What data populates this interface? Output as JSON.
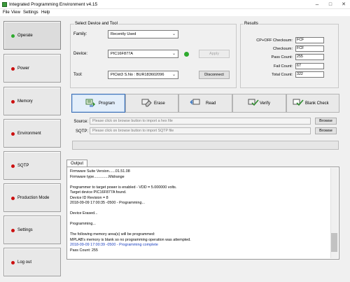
{
  "window": {
    "title": "Integrated Programming Environment v4.15",
    "min": "–",
    "max": "□",
    "close": "✕"
  },
  "menu": [
    "File",
    "View",
    "Settings",
    "Help"
  ],
  "nav": [
    {
      "label": "Operate",
      "status": "green",
      "selected": true
    },
    {
      "label": "Power",
      "status": "red"
    },
    {
      "label": "Memory",
      "status": "red"
    },
    {
      "label": "Environment",
      "status": "red"
    },
    {
      "label": "SQTP",
      "status": "red"
    },
    {
      "label": "Production Mode",
      "status": "red"
    },
    {
      "label": "Settings",
      "status": "red"
    },
    {
      "label": "Log out",
      "status": "red"
    }
  ],
  "device_tool": {
    "title": "Select Device and Tool",
    "family_label": "Family:",
    "family_value": "Recently Used",
    "device_label": "Device:",
    "device_value": "PIC16F877A",
    "apply_label": "Apply",
    "tool_label": "Tool:",
    "tool_value": "PICkit3 S.No : BUR183602096",
    "disconnect_label": "Disconnect"
  },
  "results": {
    "title": "Results",
    "rows": [
      {
        "label": "CP+OFF Checksum:",
        "value": "FCF"
      },
      {
        "label": "Checksum:",
        "value": "FCF"
      },
      {
        "label": "Pass Count:",
        "value": "255"
      },
      {
        "label": "Fail Count:",
        "value": "67"
      },
      {
        "label": "Total Count:",
        "value": "322"
      }
    ]
  },
  "actions": [
    "Program",
    "Erase",
    "Read",
    "Verify",
    "Blank Check"
  ],
  "files": {
    "source_label": "Source:",
    "source_placeholder": "Please click on browse button to import a hex file",
    "sqtp_label": "SQTP:",
    "sqtp_placeholder": "Please click on browse button to import SQTP file",
    "browse_label": "Browse"
  },
  "output": {
    "tab": "Output",
    "lines": [
      {
        "text": "Firmware Suite Version......01.51.08",
        "color": "#000000"
      },
      {
        "text": "Firmware type..............Midrange",
        "color": "#000000"
      },
      {
        "text": "",
        "color": "#000000"
      },
      {
        "text": "Programmer to target power is enabled - VDD = 5.000000 volts.",
        "color": "#000000"
      },
      {
        "text": "Target device PIC16F877A found.",
        "color": "#000000"
      },
      {
        "text": "Device ID Revision = 8",
        "color": "#000000"
      },
      {
        "text": "2018-09-09 17:00:35 -0500 - Programming...",
        "color": "#000000"
      },
      {
        "text": "",
        "color": "#000000"
      },
      {
        "text": "Device Erased...",
        "color": "#000000"
      },
      {
        "text": "",
        "color": "#000000"
      },
      {
        "text": "Programming...",
        "color": "#000000"
      },
      {
        "text": "",
        "color": "#000000"
      },
      {
        "text": "The following memory area(s) will be programmed:",
        "color": "#000000"
      },
      {
        "text": "MPLAB's memory is blank so no programming operation was attempted.",
        "color": "#000000"
      },
      {
        "text": "2018-09-09 17:00:39 -0500 - Programming complete",
        "color": "#1a3fbf"
      },
      {
        "text": "Pass Count: 255",
        "color": "#000000"
      }
    ]
  },
  "colors": {
    "status_ok": "#2eaa2e",
    "status_off": "#cc1010",
    "selected_border": "#3b6fb6"
  }
}
